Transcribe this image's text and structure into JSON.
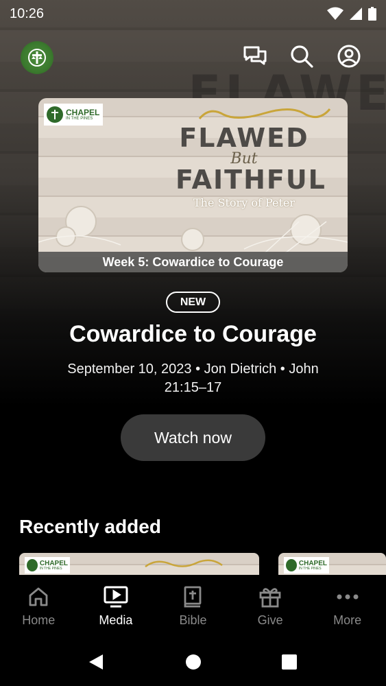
{
  "status_bar": {
    "time": "10:26"
  },
  "top_bar": {
    "icons": [
      "chat-icon",
      "search-icon",
      "account-icon"
    ]
  },
  "featured": {
    "logo_line1": "CHAPEL",
    "logo_line2": "IN THE PINES",
    "art_line1": "FLAWED",
    "art_line2": "But",
    "art_line3": "FAITHFUL",
    "art_line4": "The Story of Peter",
    "caption": "Week 5: Cowardice to Courage",
    "badge": "NEW",
    "title": "Cowardice to Courage",
    "meta": "September 10, 2023 • Jon Dietrich • John 21:15–17",
    "watch_label": "Watch now"
  },
  "recent": {
    "title": "Recently added",
    "thumb_logo_line1": "CHAPEL",
    "thumb_logo_line2": "IN THE PINES"
  },
  "bottom_nav": {
    "home": "Home",
    "media": "Media",
    "bible": "Bible",
    "give": "Give",
    "more": "More",
    "active": "Media"
  },
  "colors": {
    "brand_green": "#2f6a2a",
    "button_bg": "#3a3a3a",
    "inactive_nav": "#8a8a8a"
  }
}
